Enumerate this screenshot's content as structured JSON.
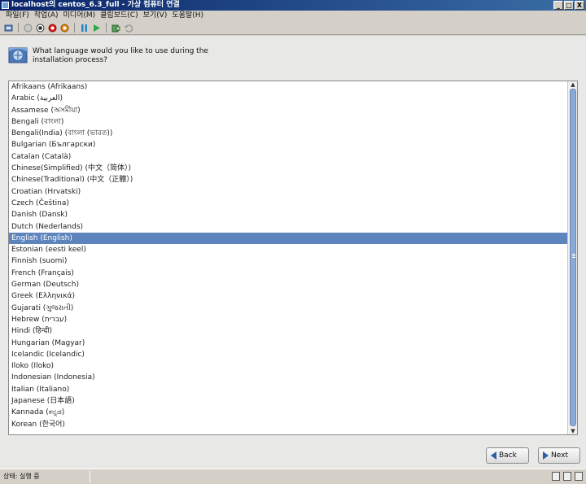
{
  "window": {
    "title": "localhost의 centos_6.3_full - 가상 컴퓨터 연결",
    "minimize": "_",
    "maximize": "□",
    "close": "X"
  },
  "menu": [
    "파일(F)",
    "작업(A)",
    "미디어(M)",
    "클립보드(C)",
    "보기(V)",
    "도움말(H)"
  ],
  "toolbar_icons": [
    "ctrl-alt-del-icon",
    "start-icon",
    "turn-off-icon",
    "shutdown-icon",
    "save-icon",
    "pause-icon",
    "reset-icon",
    "snapshot-icon",
    "revert-icon"
  ],
  "installer": {
    "question": "What language would you like to use during the installation process?",
    "languages": [
      "Afrikaans (Afrikaans)",
      "Arabic (العربية)",
      "Assamese (অসমীয়া)",
      "Bengali (বাংলা)",
      "Bengali(India) (বাংলা (ভারত))",
      "Bulgarian (Български)",
      "Catalan (Català)",
      "Chinese(Simplified) (中文（简体）)",
      "Chinese(Traditional) (中文（正體）)",
      "Croatian (Hrvatski)",
      "Czech (Čeština)",
      "Danish (Dansk)",
      "Dutch (Nederlands)",
      "English (English)",
      "Estonian (eesti keel)",
      "Finnish (suomi)",
      "French (Français)",
      "German (Deutsch)",
      "Greek (Ελληνικά)",
      "Gujarati (ગુજરાતી)",
      "Hebrew (עברית)",
      "Hindi (हिन्दी)",
      "Hungarian (Magyar)",
      "Icelandic (Icelandic)",
      "Iloko (Iloko)",
      "Indonesian (Indonesia)",
      "Italian (Italiano)",
      "Japanese (日本語)",
      "Kannada (ಕನ್ನಡ)",
      "Korean (한국어)"
    ],
    "selected_language": "English (English)",
    "back_label": "Back",
    "next_label": "Next"
  },
  "status": {
    "text": "상태: 실행 중"
  }
}
